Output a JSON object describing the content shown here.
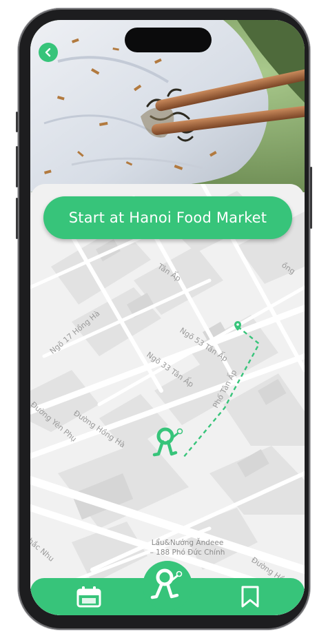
{
  "header": {
    "back_icon": "chevron-left-icon"
  },
  "cta": {
    "label": "Start at Hanoi Food Market"
  },
  "map": {
    "streets": [
      "Ngõ 17 Hồng Hà",
      "Ngõ 53 Tân Ấp",
      "Ngõ 33 Tân Ấp",
      "Phố Tân Ấp",
      "Đường Hồng Hà",
      "Đường Yên Phụ",
      "Đường Hồng Hà",
      "Tân Ấp",
      "ồng",
      "hắc Nhu"
    ],
    "poi": {
      "name": "Lẩu&Nướng Ăndeee",
      "address": "– 188 Phó Đức Chính"
    }
  },
  "tabbar": {
    "items": [
      {
        "icon": "calendar-icon"
      },
      {
        "icon": "walker-icon"
      },
      {
        "icon": "bookmark-icon"
      }
    ]
  },
  "colors": {
    "accent": "#37c47a"
  }
}
